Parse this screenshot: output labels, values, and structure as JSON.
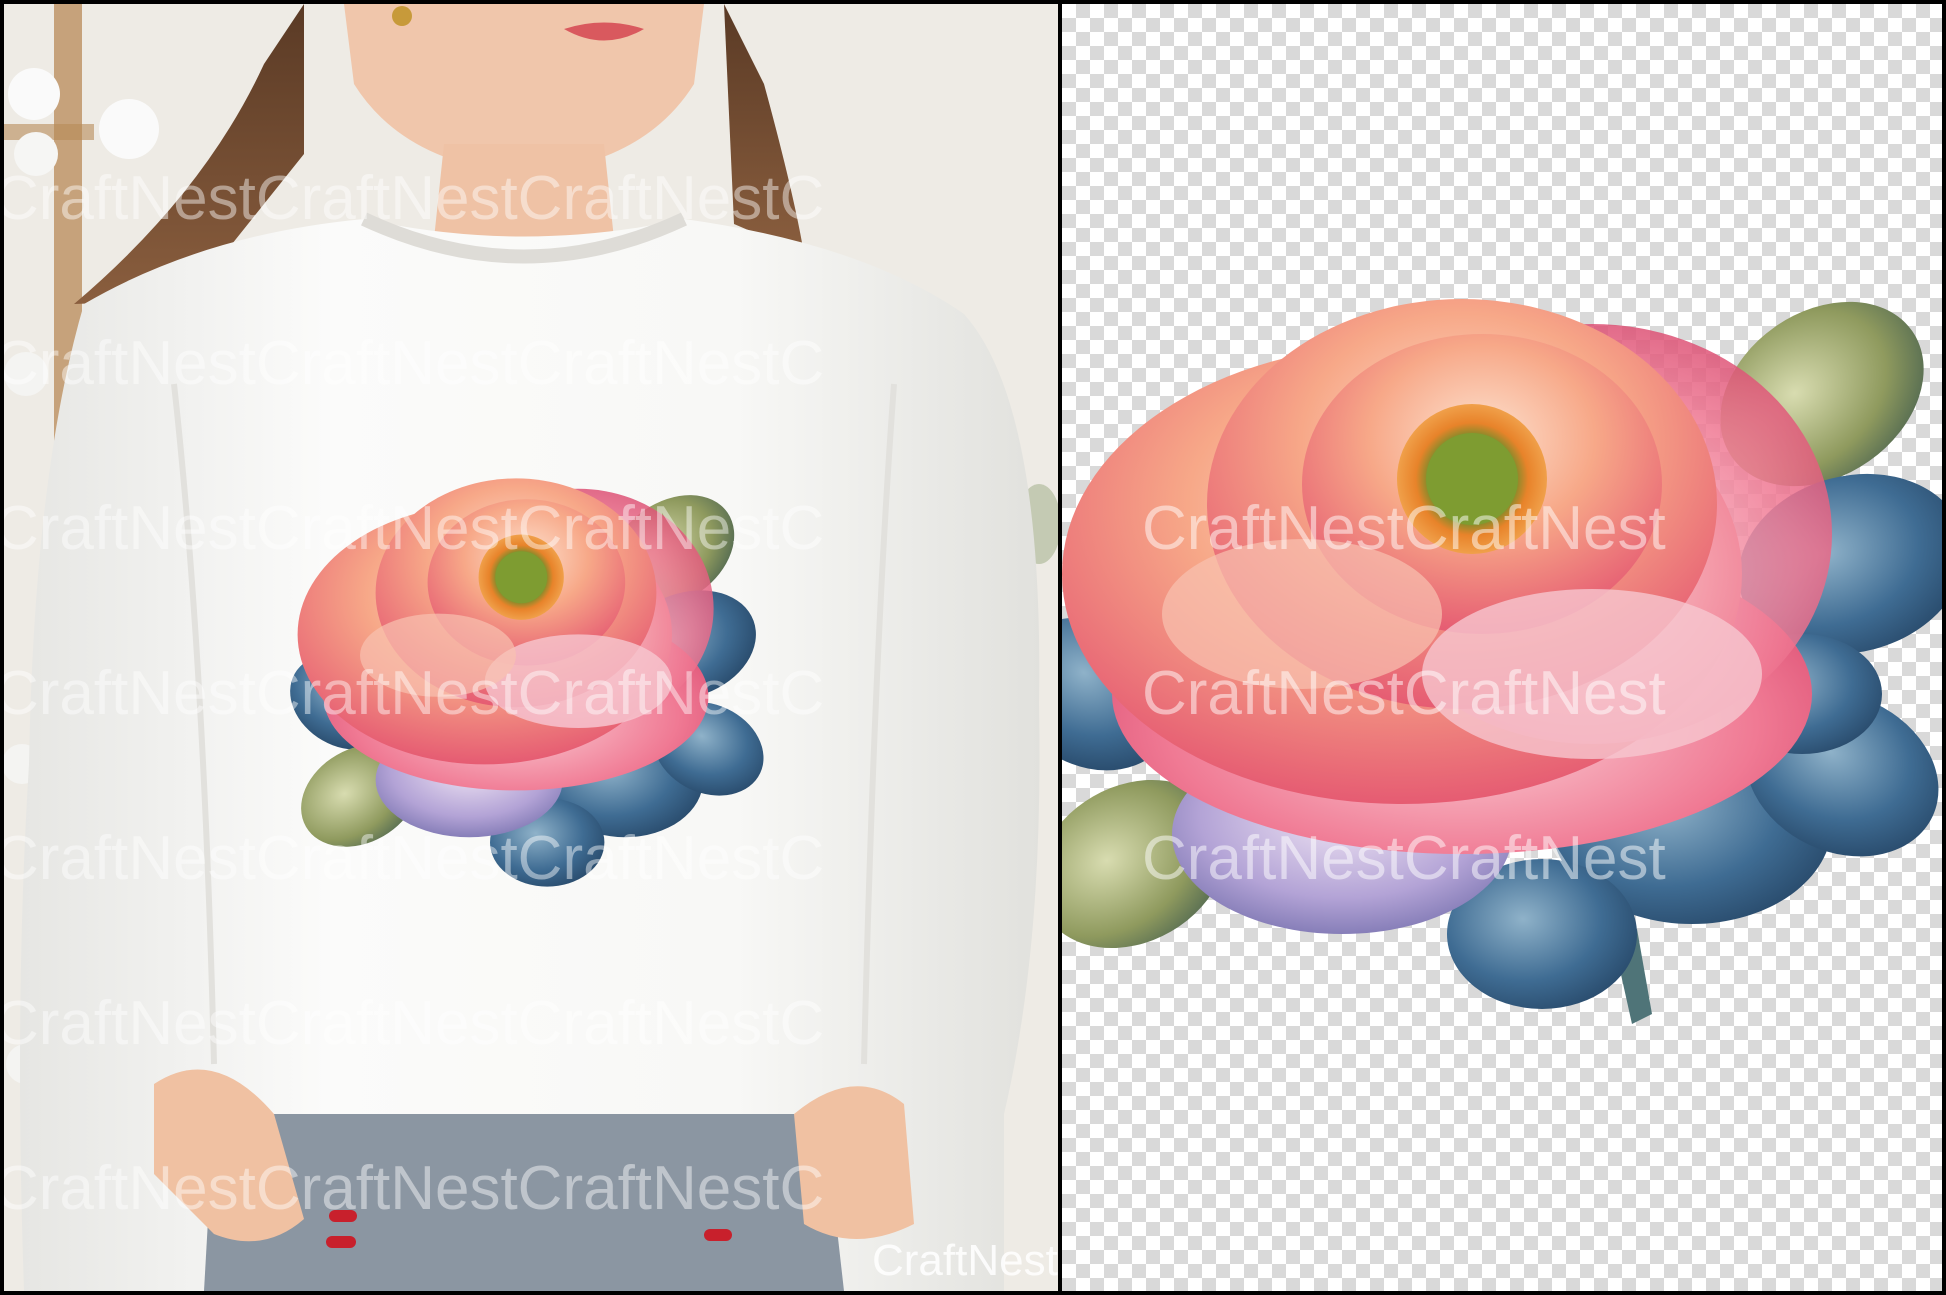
{
  "image": {
    "left_panel": {
      "subject": "woman in white sweatshirt with peony print",
      "sweatshirt_color": "#f7f7f5",
      "background_color": "#efece7"
    },
    "right_panel": {
      "subject": "peony clipart on transparent background",
      "checker_light": "#ffffff",
      "checker_dark": "#d9d9d9"
    },
    "palette": {
      "petal_pink": "#f07a94",
      "petal_peach": "#f7b28f",
      "petal_deep": "#e0456a",
      "center_green": "#8aa63a",
      "center_orange": "#e8832a",
      "leaf_blue": "#355f86",
      "leaf_teal": "#3d6d6a",
      "leaf_olive": "#8f9a5e",
      "lavender": "#a99bd0"
    }
  },
  "watermark": {
    "text": "CraftNestCraftNestCraftNestCraftNest",
    "corner_text": "CraftNest"
  }
}
